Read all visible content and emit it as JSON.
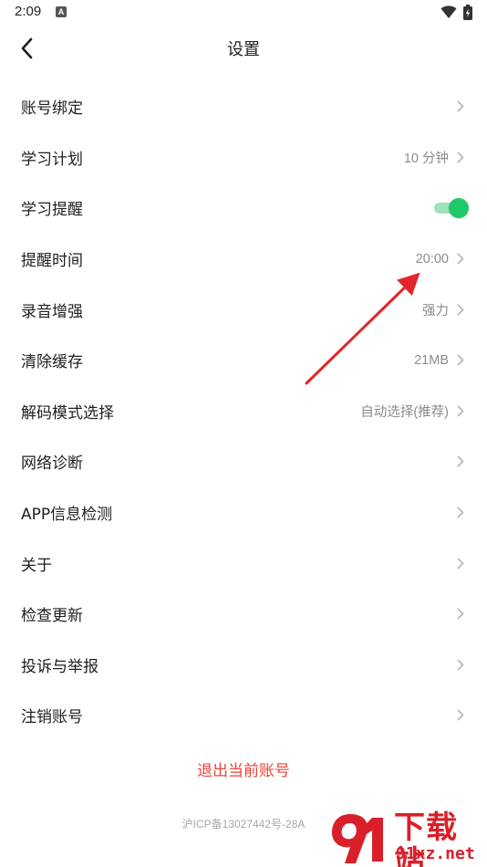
{
  "status_bar": {
    "time": "2:09",
    "notification_badge": "A"
  },
  "nav": {
    "title": "设置"
  },
  "settings": {
    "items": [
      {
        "label": "账号绑定",
        "value": ""
      },
      {
        "label": "学习计划",
        "value": "10 分钟"
      },
      {
        "label": "学习提醒",
        "value": "",
        "toggle": true,
        "toggle_on": true
      },
      {
        "label": "提醒时间",
        "value": "20:00"
      },
      {
        "label": "录音增强",
        "value": "强力"
      },
      {
        "label": "清除缓存",
        "value": "21MB"
      },
      {
        "label": "解码模式选择",
        "value": "自动选择(推荐)"
      },
      {
        "label": "网络诊断",
        "value": ""
      },
      {
        "label": "APP信息检测",
        "value": ""
      },
      {
        "label": "关于",
        "value": ""
      },
      {
        "label": "检查更新",
        "value": ""
      },
      {
        "label": "投诉与举报",
        "value": ""
      },
      {
        "label": "注销账号",
        "value": ""
      }
    ]
  },
  "footer": {
    "logout_label": "退出当前账号",
    "icp": "沪ICP备13027442号-28A"
  },
  "watermark": {
    "title": "下载站",
    "site": "91xz.net"
  },
  "colors": {
    "accent_green": "#1fc96a",
    "logout_red": "#e8453c",
    "arrow_red": "#e0262a"
  }
}
